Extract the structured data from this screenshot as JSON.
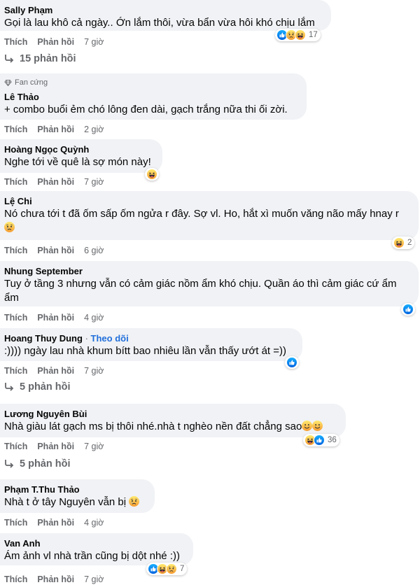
{
  "actions": {
    "like": "Thích",
    "reply": "Phản hồi"
  },
  "colors": {
    "bubble": "#f0f2f5",
    "link": "#216fdb",
    "muted": "#65676b"
  },
  "comments": [
    {
      "author": "Sally Phạm",
      "text": "Gọi là lau khô cả ngày.. Ớn lắm thôi, vừa bẩn vừa hôi khó chịu lắm",
      "time": "7 giờ",
      "reaction_count": "17",
      "replies": "15 phản hồi"
    },
    {
      "badge": "Fan cứng",
      "author": "Lê Thảo",
      "text": "+ combo buổi ẻm chó lông đen dài, gạch trắng nữa thi ối zời.",
      "time": "2 giờ"
    },
    {
      "author": "Hoàng Ngọc Quỳnh",
      "text": "Nghe tới về quê là sợ món này!",
      "time": "7 giờ"
    },
    {
      "author": "Lệ Chi",
      "text": "Nó chưa tới t đã ốm sấp ốm ngửa r đây. Sợ vl. Ho, hắt xì muốn văng não mấy hnay r",
      "time": "6 giờ",
      "reaction_count": "2"
    },
    {
      "author": "Nhung September",
      "text": "Tuy ở tầng 3 nhưng vẫn có cảm giác nồm ẩm khó chịu. Quần áo thì cảm giác cứ ẩm ẩm",
      "time": "4 giờ"
    },
    {
      "author": "Hoang Thuy Dung",
      "follow": "Theo dõi",
      "text": ":)))) ngày lau nhà khum bítt bao nhiêu lần vẫn thấy ướt át =))",
      "time": "7 giờ",
      "replies": "5 phản hồi"
    },
    {
      "author": "Lương Nguyên Bùi",
      "text": "Nhà giàu lát gạch ms bị thôi nhé.nhà t nghèo nền đất chẳng sao",
      "time": "7 giờ",
      "reaction_count": "36",
      "replies": "5 phản hồi"
    },
    {
      "author": "Phạm T.Thu Thảo",
      "text": "Nhà t ở tây Nguyên vẫn bị",
      "time": "4 giờ"
    },
    {
      "author": "Van Anh",
      "text": "Ám ảnh vl nhà trần cũng bị dột nhé :))",
      "time": "7 giờ",
      "reaction_count": "7"
    }
  ]
}
